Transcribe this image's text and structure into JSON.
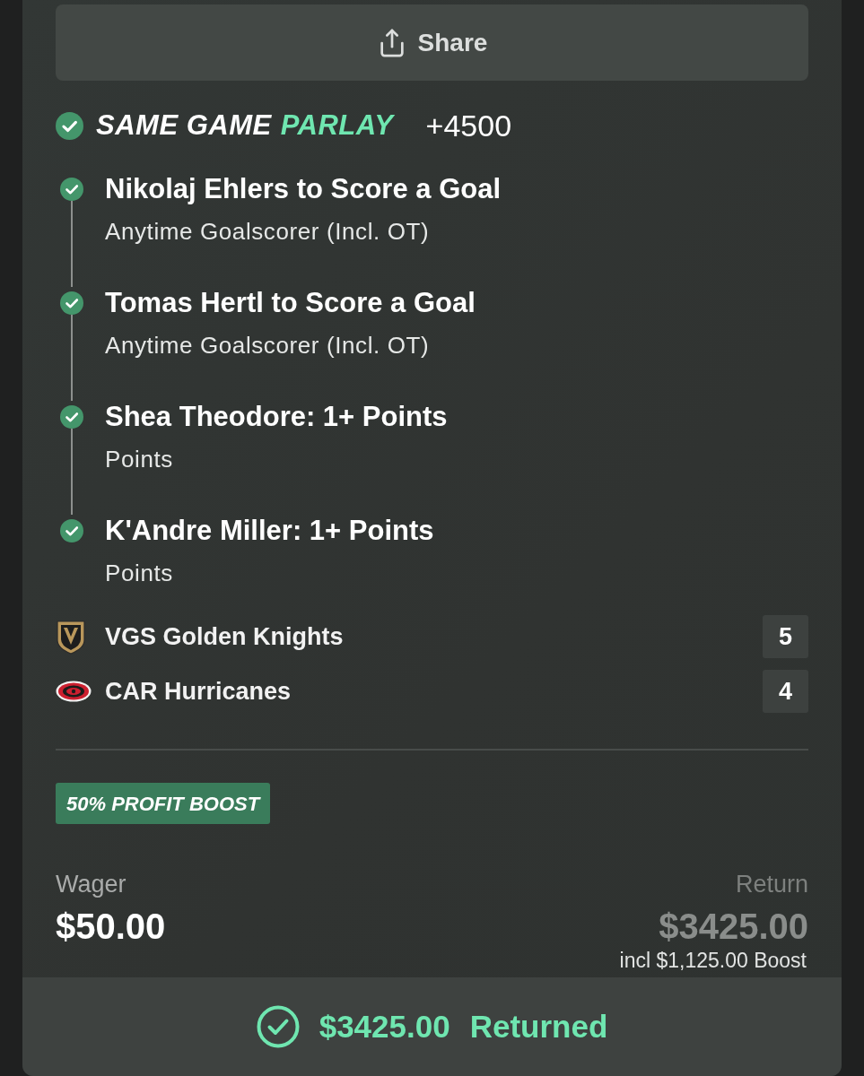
{
  "share_button": {
    "label": "Share"
  },
  "parlay": {
    "won": true,
    "title": "SAME GAME",
    "title_accent": "PARLAY",
    "odds": "+4500"
  },
  "legs": [
    {
      "title": "Nikolaj Ehlers to Score a Goal",
      "market": "Anytime Goalscorer (Incl. OT)",
      "won": true
    },
    {
      "title": "Tomas Hertl to Score a Goal",
      "market": "Anytime Goalscorer (Incl. OT)",
      "won": true
    },
    {
      "title": "Shea Theodore: 1+ Points",
      "market": "Points",
      "won": true
    },
    {
      "title": "K'Andre Miller: 1+ Points",
      "market": "Points",
      "won": true
    }
  ],
  "teams": [
    {
      "kind": "helmet",
      "name": "VGS Golden Knights",
      "score": "5"
    },
    {
      "kind": "hurricane",
      "name": "CAR Hurricanes",
      "score": "4"
    }
  ],
  "boost_badge": "50% PROFIT BOOST",
  "wager": {
    "label": "Wager",
    "amount": "$50.00"
  },
  "return": {
    "label": "Return",
    "amount": "$3425.00",
    "note": "incl $1,125.00 Boost"
  },
  "result": {
    "won": true,
    "amount": "$3425.00",
    "label": "Returned"
  }
}
